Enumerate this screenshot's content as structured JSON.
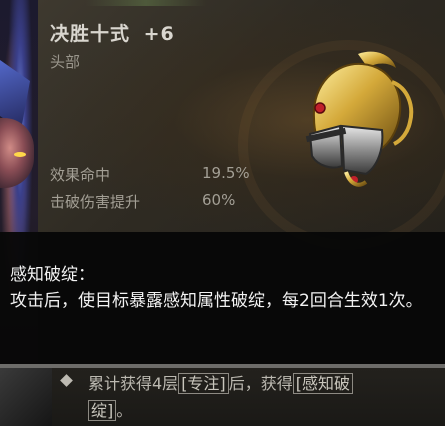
{
  "item": {
    "name": "决胜十式",
    "level": "+6",
    "slot": "头部",
    "stats": [
      {
        "name": "效果命中",
        "value": "19.5%"
      },
      {
        "name": "击破伤害提升",
        "value": "60%"
      }
    ]
  },
  "skill": {
    "title": "感知破绽：",
    "description": "攻击后，使目标暴露感知属性破绽，每2回合生效1次。"
  },
  "related": {
    "text_before": "累计获得4层",
    "tag1": "[专注]",
    "text_middle": "后，获得",
    "tag2_line1": "[感知破",
    "tag2_line2": "绽]",
    "text_after": "。"
  },
  "icons": {
    "helmet": "golden-helmet-icon",
    "bullet": "diamond-bullet-icon"
  },
  "colors": {
    "title": "#d9d6cf",
    "stat": "#a39f95",
    "description": "#f2f2f2"
  }
}
